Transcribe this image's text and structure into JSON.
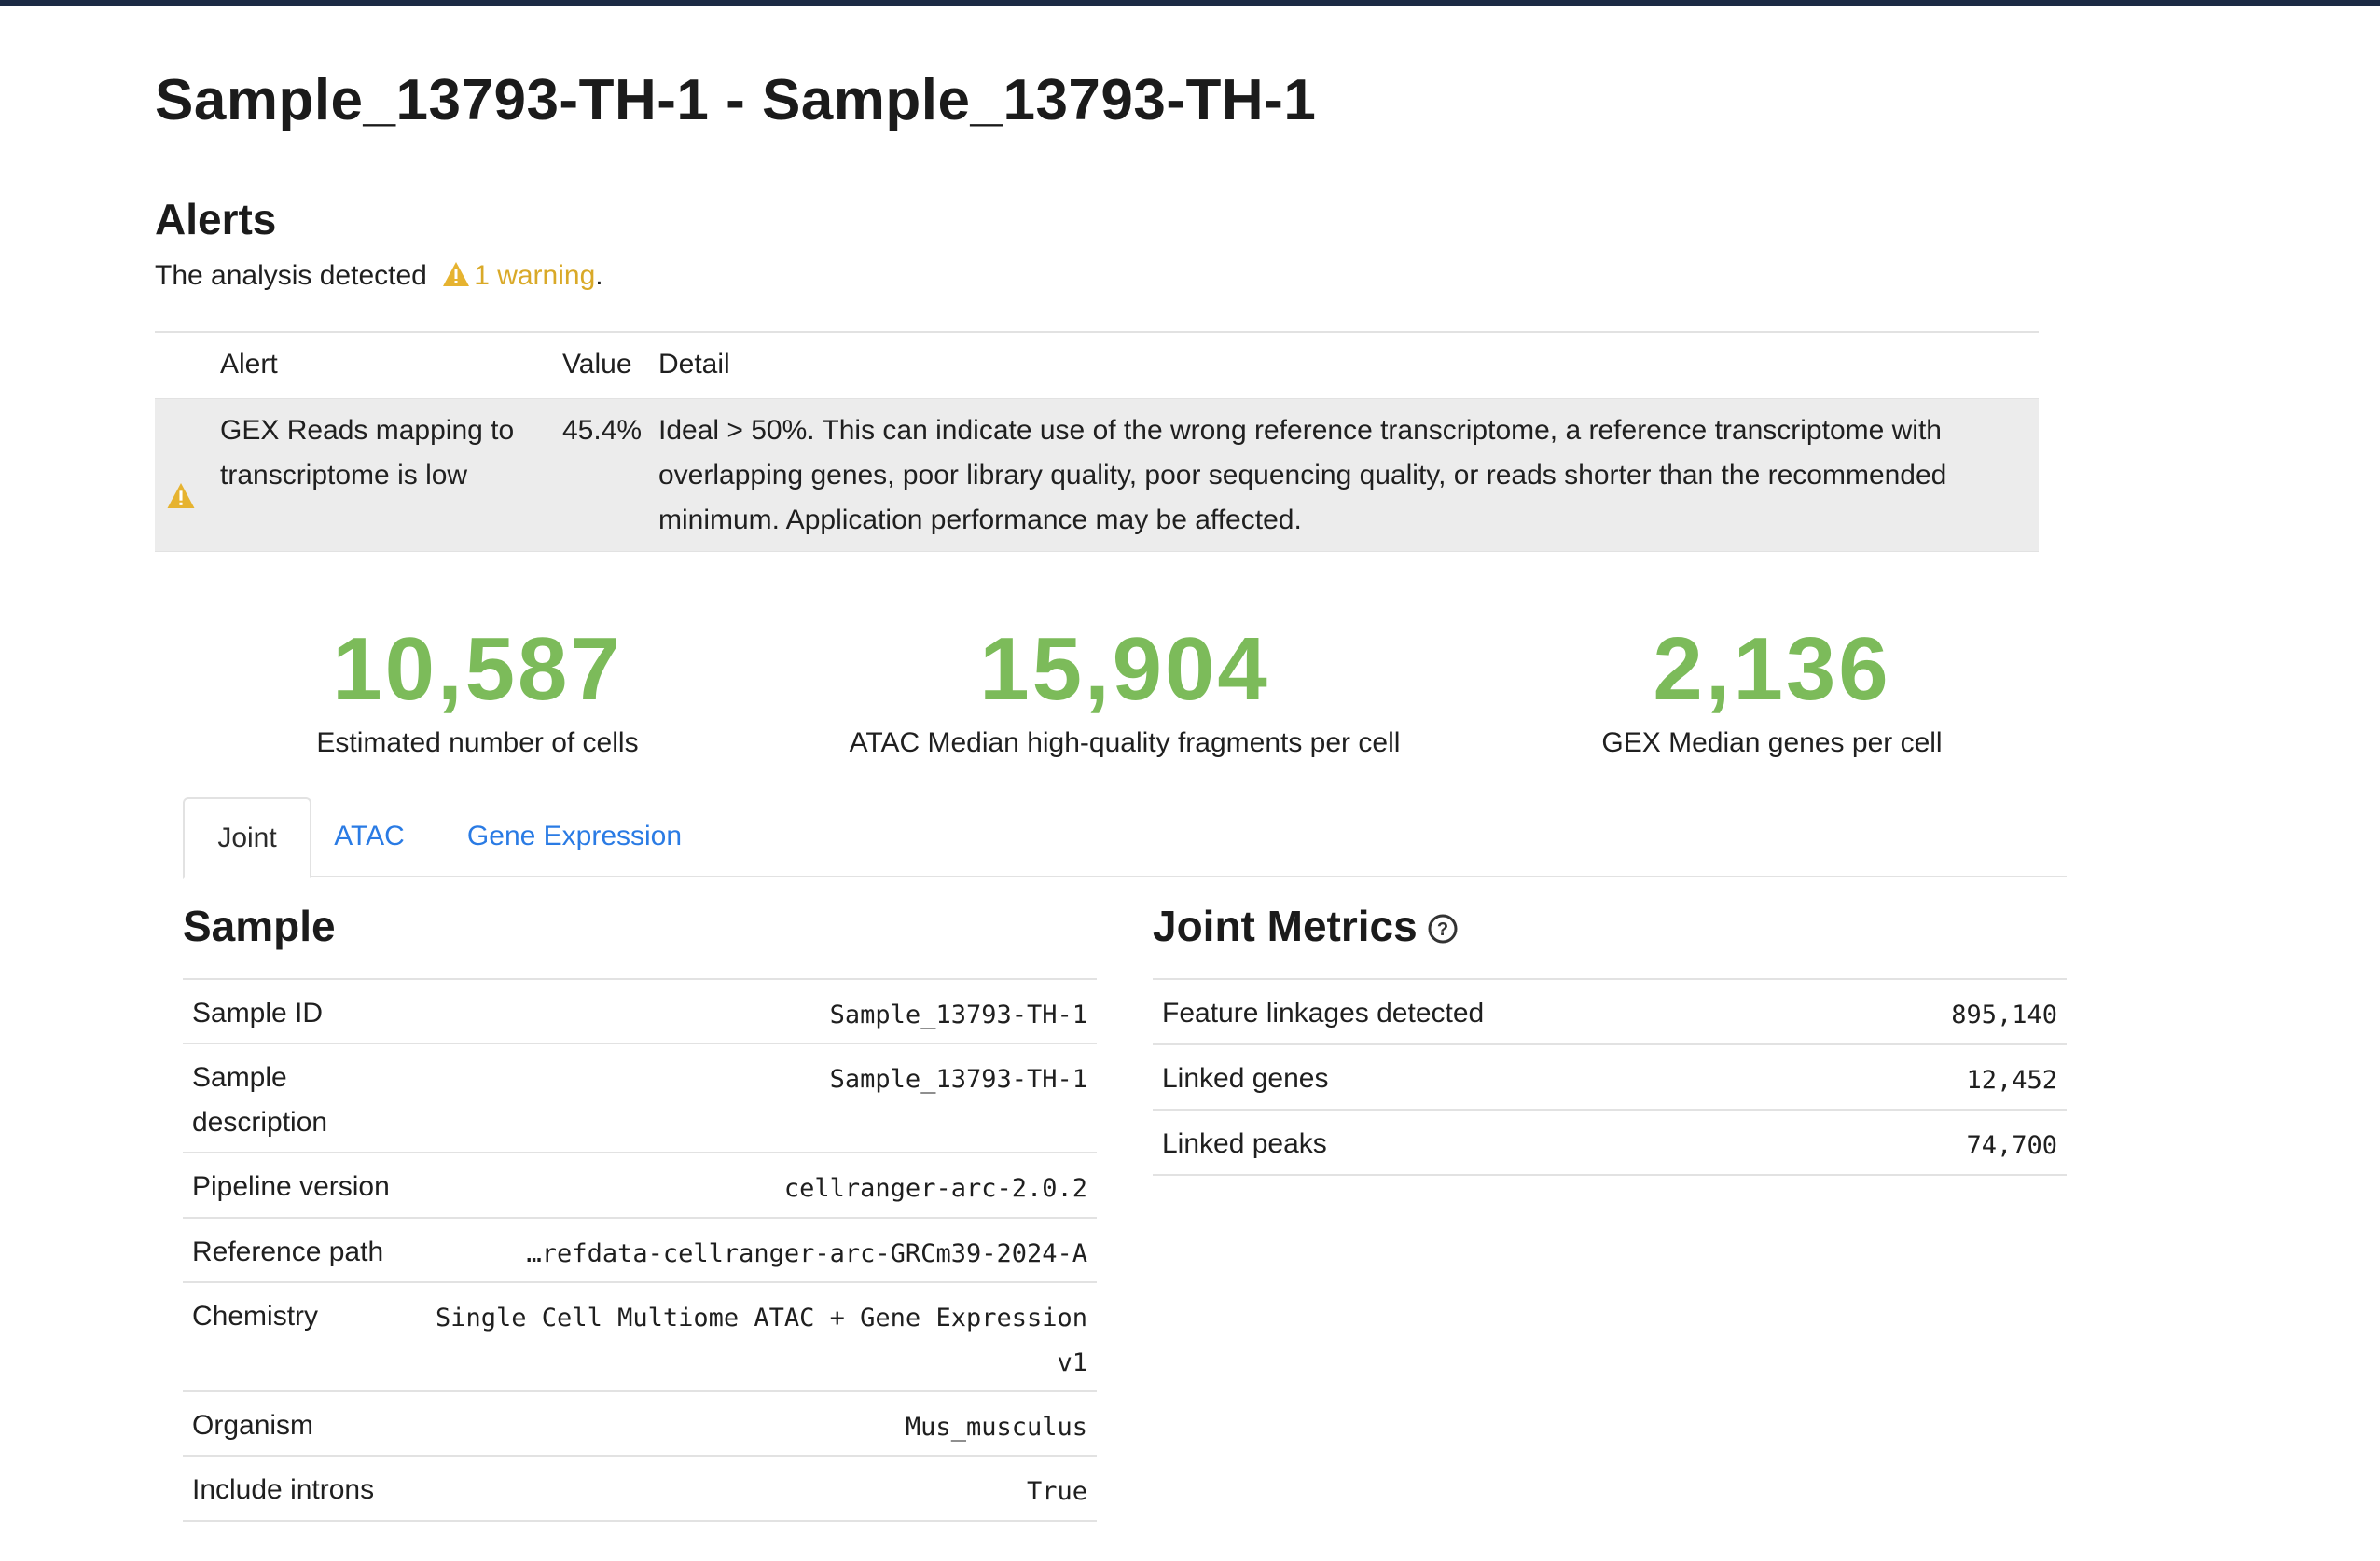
{
  "page": {
    "title": "Sample_13793-TH-1 - Sample_13793-TH-1"
  },
  "alerts": {
    "heading": "Alerts",
    "summary_prefix": "The analysis detected",
    "warning_link": "1 warning",
    "summary_suffix": ".",
    "columns": {
      "alert": "Alert",
      "value": "Value",
      "detail": "Detail"
    },
    "rows": [
      {
        "icon": "warning-icon",
        "alert": "GEX Reads mapping to transcriptome is low",
        "value": "45.4%",
        "detail": "Ideal > 50%. This can indicate use of the wrong reference transcriptome, a reference transcriptome with overlapping genes, poor library quality, poor sequencing quality, or reads shorter than the recommended minimum. Application performance may be affected."
      }
    ]
  },
  "hero_metrics": [
    {
      "value": "10,587",
      "label": "Estimated number of cells"
    },
    {
      "value": "15,904",
      "label": "ATAC Median high-quality fragments per cell"
    },
    {
      "value": "2,136",
      "label": "GEX Median genes per cell"
    }
  ],
  "tabs": [
    {
      "label": "Joint",
      "active": true
    },
    {
      "label": "ATAC",
      "active": false
    },
    {
      "label": "Gene Expression",
      "active": false
    }
  ],
  "sample": {
    "title": "Sample",
    "rows": [
      {
        "key": "Sample ID",
        "value": "Sample_13793-TH-1"
      },
      {
        "key": "Sample description",
        "value": "Sample_13793-TH-1"
      },
      {
        "key": "Pipeline version",
        "value": "cellranger-arc-2.0.2"
      },
      {
        "key": "Reference path",
        "value": "…refdata-cellranger-arc-GRCm39-2024-A"
      },
      {
        "key": "Chemistry",
        "value": "Single Cell Multiome ATAC + Gene Expression v1"
      },
      {
        "key": "Organism",
        "value": "Mus_musculus"
      },
      {
        "key": "Include introns",
        "value": "True"
      }
    ]
  },
  "joint_metrics": {
    "title": "Joint Metrics",
    "help_icon": "question-circle-icon",
    "rows": [
      {
        "key": "Feature linkages detected",
        "value": "895,140"
      },
      {
        "key": "Linked genes",
        "value": "12,452"
      },
      {
        "key": "Linked peaks",
        "value": "74,700"
      }
    ]
  },
  "colors": {
    "accent_green": "#7cbb5a",
    "warning": "#e6b330",
    "link": "#2a7be4",
    "topbar": "#1c2a44"
  }
}
